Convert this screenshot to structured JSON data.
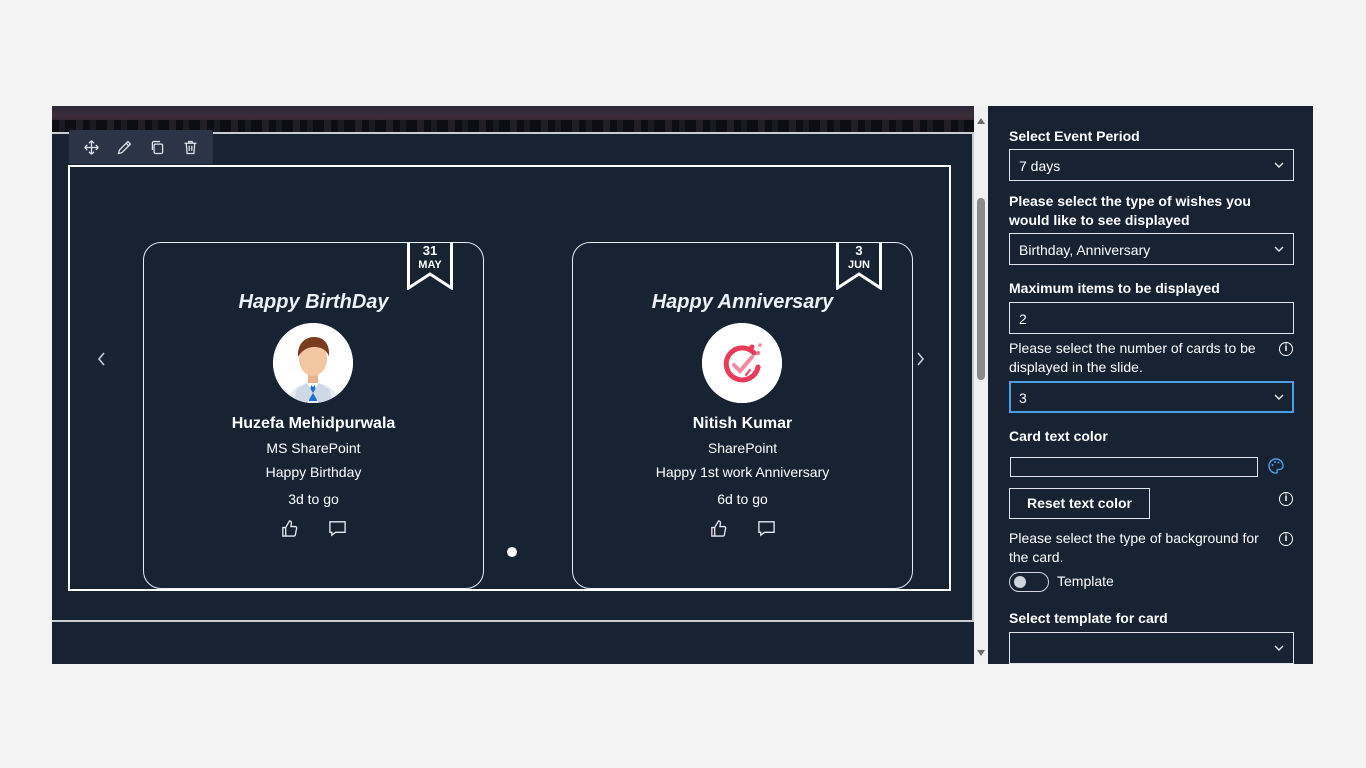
{
  "toolbar": {
    "icons": [
      "move-icon",
      "edit-icon",
      "duplicate-icon",
      "delete-icon"
    ]
  },
  "cards": [
    {
      "date_day": "31",
      "date_month": "MAY",
      "title": "Happy BirthDay",
      "name": "Huzefa Mehidpurwala",
      "department": "MS SharePoint",
      "message": "Happy Birthday",
      "countdown": "3d to go"
    },
    {
      "date_day": "3",
      "date_month": "JUN",
      "title": "Happy Anniversary",
      "name": "Nitish Kumar",
      "department": "SharePoint",
      "message": "Happy 1st work Anniversary",
      "countdown": "6d to go"
    }
  ],
  "panel": {
    "event_period_label": "Select Event Period",
    "event_period_value": "7 days",
    "wish_type_label": "Please select the type of wishes you would like to see displayed",
    "wish_type_value": "Birthday, Anniversary",
    "max_items_label": "Maximum items to be displayed",
    "max_items_value": "2",
    "cards_in_slide_label": "Please select the number of cards to be displayed in the slide.",
    "cards_in_slide_value": "3",
    "text_color_label": "Card text color",
    "text_color_value": "",
    "reset_button": "Reset text color",
    "background_type_label": "Please select the type of background for the card.",
    "background_toggle_label": "Template",
    "template_label": "Select template for card",
    "template_value": "",
    "info_glyph": "i"
  },
  "colors": {
    "background": "#172233",
    "accent_focus": "#4b9fe6",
    "page_bg": "#f3f3f3"
  }
}
